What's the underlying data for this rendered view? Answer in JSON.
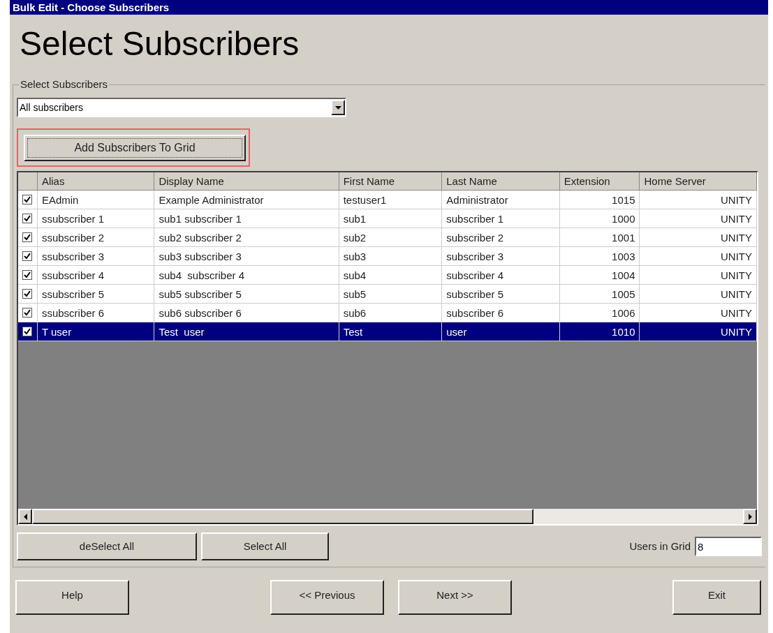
{
  "window": {
    "title": "Bulk Edit - Choose Subscribers"
  },
  "heading": "Select Subscribers",
  "group": {
    "label": "Select Subscribers",
    "dropdown": {
      "value": "All subscribers"
    },
    "add_button": "Add Subscribers To Grid"
  },
  "table": {
    "columns": [
      "Alias",
      "Display Name",
      "First Name",
      "Last Name",
      "Extension",
      "Home Server"
    ],
    "rows": [
      {
        "checked": true,
        "selected": false,
        "cells": [
          "EAdmin",
          "Example Administrator",
          "testuser1",
          "Administrator",
          "1015",
          "UNITY"
        ]
      },
      {
        "checked": true,
        "selected": false,
        "cells": [
          "ssubscriber 1",
          "sub1 subscriber 1",
          "sub1",
          "subscriber 1",
          "1000",
          "UNITY"
        ]
      },
      {
        "checked": true,
        "selected": false,
        "cells": [
          "ssubscriber 2",
          "sub2 subscriber 2",
          "sub2",
          "subscriber 2",
          "1001",
          "UNITY"
        ]
      },
      {
        "checked": true,
        "selected": false,
        "cells": [
          "ssubscriber 3",
          "sub3 subscriber 3",
          "sub3",
          "subscriber 3",
          "1003",
          "UNITY"
        ]
      },
      {
        "checked": true,
        "selected": false,
        "cells": [
          "ssubscriber 4",
          "sub4  subscriber 4",
          "sub4",
          "subscriber 4",
          "1004",
          "UNITY"
        ]
      },
      {
        "checked": true,
        "selected": false,
        "cells": [
          "ssubscriber 5",
          "sub5 subscriber 5",
          "sub5",
          "subscriber 5",
          "1005",
          "UNITY"
        ]
      },
      {
        "checked": true,
        "selected": false,
        "cells": [
          "ssubscriber 6",
          "sub6 subscriber 6",
          "sub6",
          "subscriber 6",
          "1006",
          "UNITY"
        ]
      },
      {
        "checked": true,
        "selected": true,
        "cells": [
          "T user",
          "Test  user",
          "Test",
          "user",
          "1010",
          "UNITY"
        ]
      }
    ]
  },
  "grid_buttons": [
    "deSelect All",
    "Select All"
  ],
  "users_in_grid": {
    "label": "Users in Grid",
    "value": "8"
  },
  "footer_buttons": [
    "Help",
    "<< Previous",
    "Next >>",
    "Exit"
  ]
}
